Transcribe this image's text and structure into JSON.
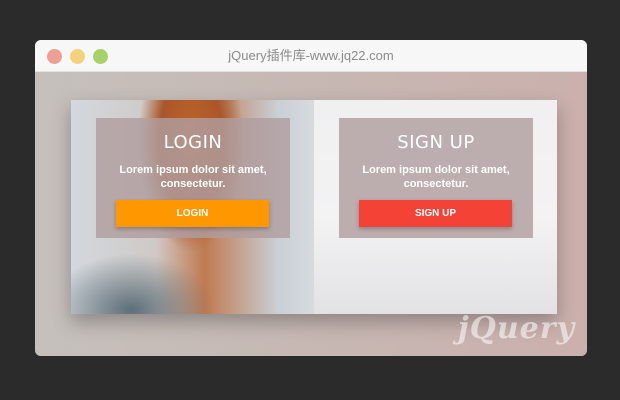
{
  "window": {
    "title": "jQuery插件库-www.jq22.com"
  },
  "login": {
    "title": "LOGIN",
    "text": "Lorem ipsum dolor sit amet, consectetur.",
    "button_label": "LOGIN"
  },
  "signup": {
    "title": "SIGN UP",
    "text": "Lorem ipsum dolor sit amet, consectetur.",
    "button_label": "SIGN UP"
  },
  "watermark": {
    "text": "jQuery"
  },
  "colors": {
    "login_button": "#ff9800",
    "signup_button": "#f44336",
    "card_overlay": "#b09ea0"
  }
}
